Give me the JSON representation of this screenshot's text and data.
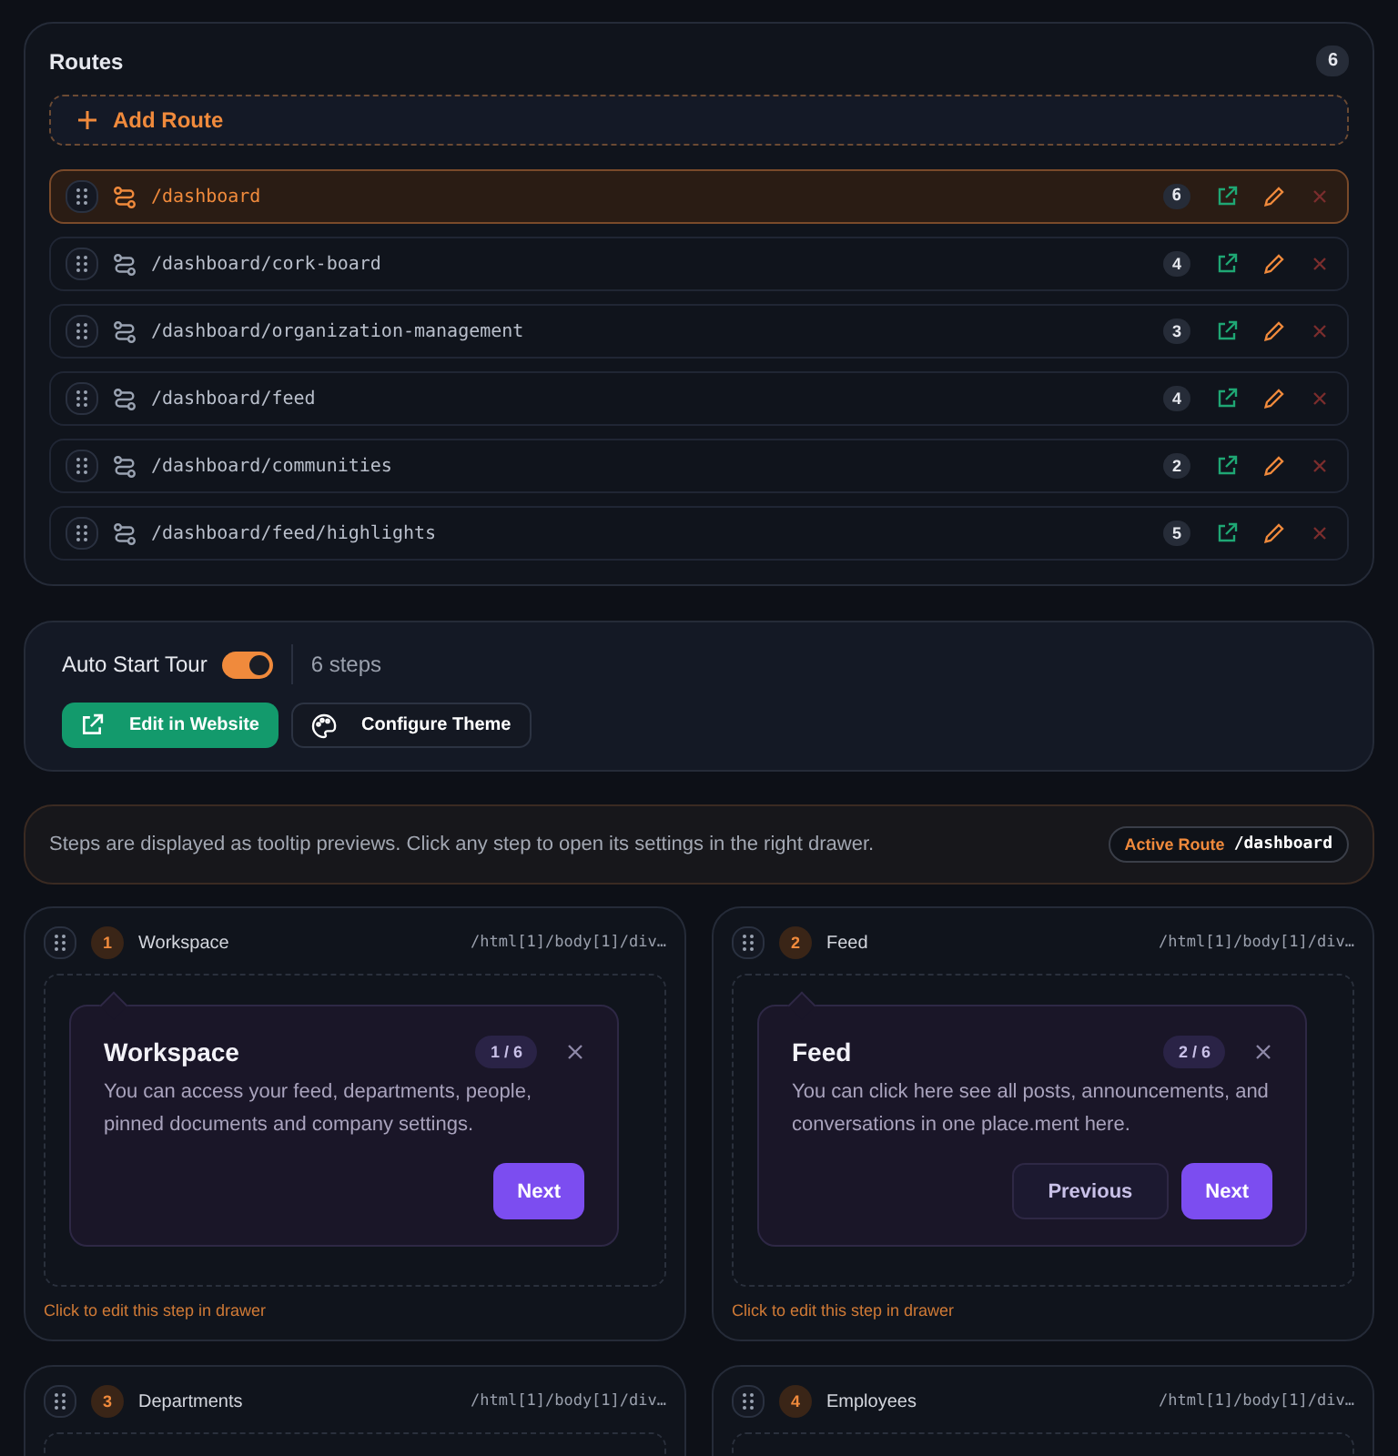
{
  "routes": {
    "title": "Routes",
    "count": "6",
    "add_label": "Add Route",
    "items": [
      {
        "path": "/dashboard",
        "count": "6",
        "selected": true
      },
      {
        "path": "/dashboard/cork-board",
        "count": "4",
        "selected": false
      },
      {
        "path": "/dashboard/organization-management",
        "count": "3",
        "selected": false
      },
      {
        "path": "/dashboard/feed",
        "count": "4",
        "selected": false
      },
      {
        "path": "/dashboard/communities",
        "count": "2",
        "selected": false
      },
      {
        "path": "/dashboard/feed/highlights",
        "count": "5",
        "selected": false
      }
    ]
  },
  "tour": {
    "label": "Auto Start Tour",
    "on": true,
    "steps_label": "6 steps",
    "buttons": [
      {
        "kind": "primary",
        "label": "Edit in Website"
      },
      {
        "kind": "secondary",
        "label": "Configure Theme"
      }
    ]
  },
  "info": {
    "text": "Steps are displayed as tooltip previews. Click any step to open its settings in the right drawer.",
    "active_label": "Active Route",
    "active_path": "/dashboard"
  },
  "steps": [
    {
      "number": "1",
      "name": "Workspace",
      "selector": "/html[1]/body[1]/div…",
      "preview": {
        "title": "Workspace",
        "progress": "1 / 6",
        "body": "You can access your feed, departments, people, pinned documents and company settings.",
        "buttons": [
          {
            "kind": "next",
            "label": "Next"
          }
        ]
      },
      "hint": "Click to edit this step in drawer"
    },
    {
      "number": "2",
      "name": "Feed",
      "selector": "/html[1]/body[1]/div…",
      "preview": {
        "title": "Feed",
        "progress": "2 / 6",
        "body": "You can click here see all posts, announcements, and conversations in one place.ment here.",
        "buttons": [
          {
            "kind": "previous",
            "label": "Previous"
          },
          {
            "kind": "next",
            "label": "Next"
          }
        ]
      },
      "hint": "Click to edit this step in drawer"
    },
    {
      "number": "3",
      "name": "Departments",
      "selector": "/html[1]/body[1]/div…"
    },
    {
      "number": "4",
      "name": "Employees",
      "selector": "/html[1]/body[1]/div…"
    }
  ]
}
